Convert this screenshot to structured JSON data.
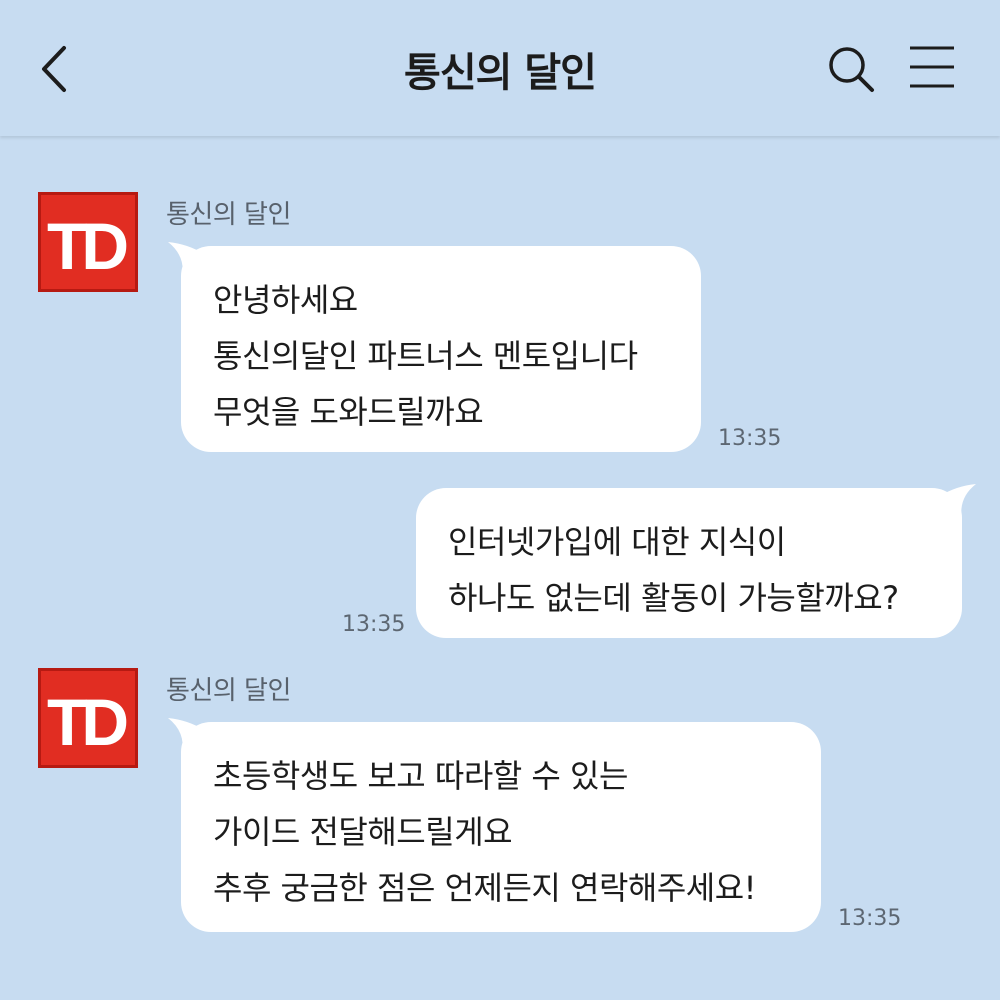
{
  "header": {
    "title": "통신의 달인",
    "back_icon": "chevron-left-icon",
    "search_icon": "search-icon",
    "menu_icon": "hamburger-menu-icon"
  },
  "colors": {
    "background": "#c7dcf1",
    "bubble": "#ffffff",
    "avatar_red": "#e12d22"
  },
  "messages": [
    {
      "direction": "received",
      "sender": "통신의 달인",
      "avatar_text": "TD",
      "lines": [
        "안녕하세요",
        "통신의달인 파트너스 멘토입니다",
        "무엇을 도와드릴까요"
      ],
      "time": "13:35"
    },
    {
      "direction": "sent",
      "lines": [
        "인터넷가입에 대한 지식이",
        "하나도 없는데 활동이 가능할까요?"
      ],
      "time": "13:35"
    },
    {
      "direction": "received",
      "sender": "통신의 달인",
      "avatar_text": "TD",
      "lines": [
        "초등학생도 보고 따라할 수 있는",
        "가이드 전달해드릴게요",
        "추후 궁금한 점은 언제든지 연락해주세요!"
      ],
      "time": "13:35"
    }
  ]
}
